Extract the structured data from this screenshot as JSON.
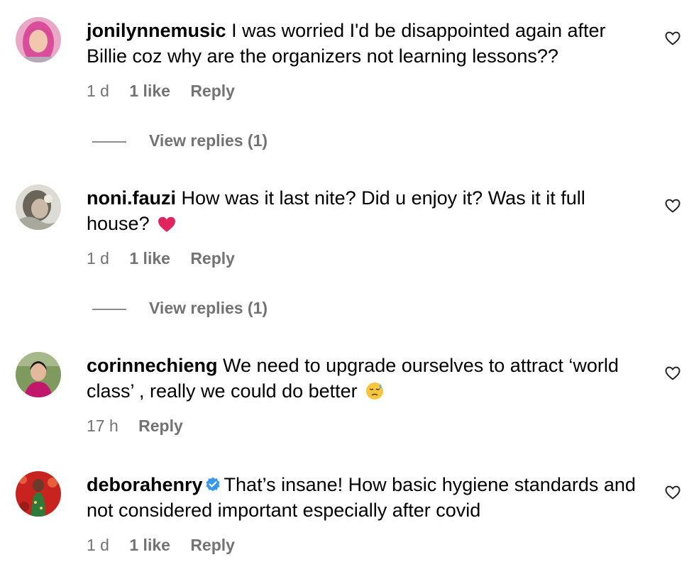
{
  "comments": [
    {
      "username": "jonilynnemusic",
      "text": "I was worried I'd be disappointed again after Billie coz why are the organizers not learning lessons??",
      "time": "1 d",
      "likes": "1 like",
      "reply": "Reply",
      "view_replies": "View replies (1)",
      "verified": false
    },
    {
      "username": "noni.fauzi",
      "text": "How was it last nite? Did u enjoy it? Was it it full house?",
      "emoji": "heart-emoji",
      "time": "1 d",
      "likes": "1 like",
      "reply": "Reply",
      "view_replies": "View replies (1)",
      "verified": false
    },
    {
      "username": "corinnechieng",
      "text": "We need to upgrade ourselves to attract ‘world class’ , really we could do better",
      "emoji": "downcast-sweat-emoji",
      "time": "17 h",
      "reply": "Reply",
      "verified": false
    },
    {
      "username": "deborahenry",
      "text": "That’s insane! How basic hygiene standards and not considered important especially after covid",
      "time": "1 d",
      "likes": "1 like",
      "reply": "Reply",
      "verified": true
    }
  ],
  "colors": {
    "text": "#000000",
    "meta": "#737373",
    "verified_badge": "#3897f0",
    "heart_emoji": "#e0245e"
  }
}
